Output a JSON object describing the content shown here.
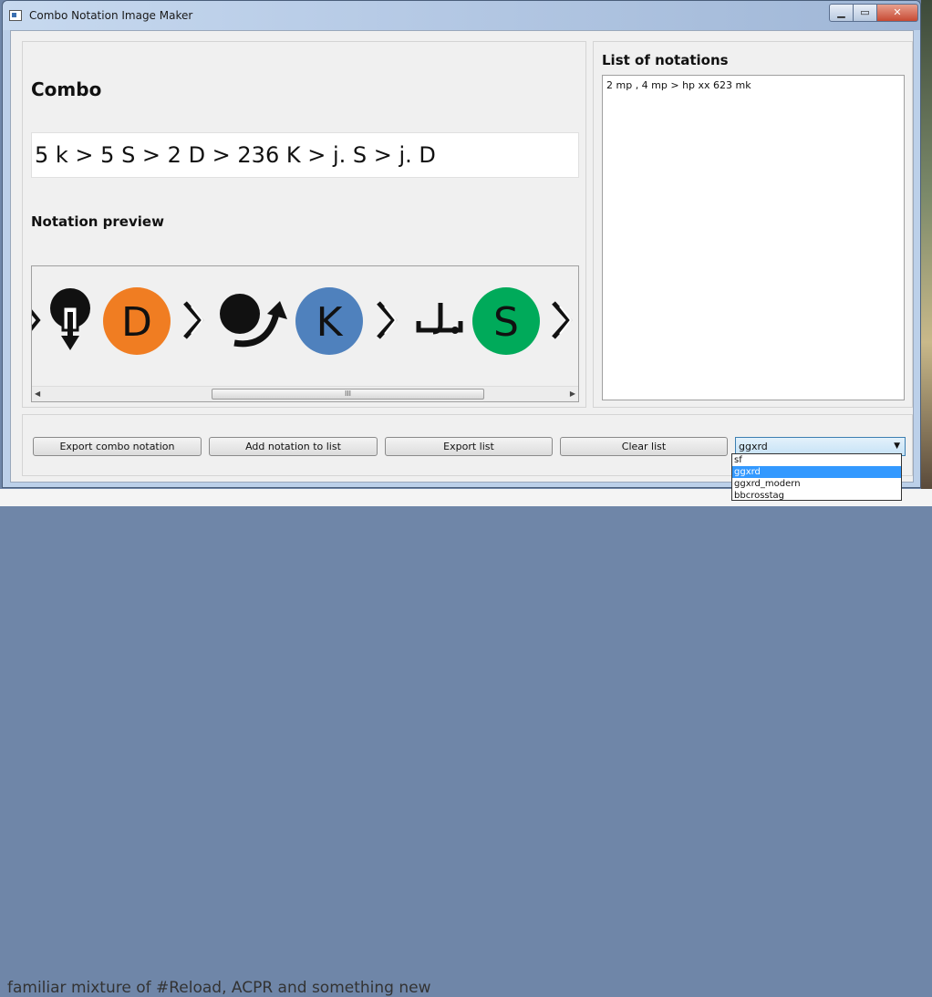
{
  "window": {
    "title": "Combo Notation Image Maker"
  },
  "combo": {
    "heading": "Combo",
    "value": "5 k > 5 S > 2 D > 236 K > j. S > j. D"
  },
  "preview": {
    "heading": "Notation preview",
    "icons": [
      "chevron-right",
      "down-arrow-stick",
      "D-button",
      "chevron-right",
      "quarter-circle-forward",
      "K-button",
      "chevron-right",
      "jump-j",
      "S-button",
      "chevron-right"
    ],
    "button_colors": {
      "D": "#f07d22",
      "K": "#4f81bd",
      "S": "#00aa5a"
    },
    "button_letters": {
      "D": "D",
      "K": "K",
      "S": "S"
    },
    "scroll_grip": "III"
  },
  "notations_list": {
    "heading": "List of notations",
    "items": [
      "2 mp , 4 mp > hp xx 623 mk"
    ]
  },
  "toolbar": {
    "export_combo": "Export combo notation",
    "add_to_list": "Add notation to list",
    "export_list": "Export list",
    "clear_list": "Clear list"
  },
  "style_select": {
    "selected": "ggxrd",
    "options": [
      "sf",
      "ggxrd",
      "ggxrd_modern",
      "bbcrosstag"
    ]
  },
  "background": {
    "text": "familiar mixture of #Reload, ACPR and something new"
  }
}
